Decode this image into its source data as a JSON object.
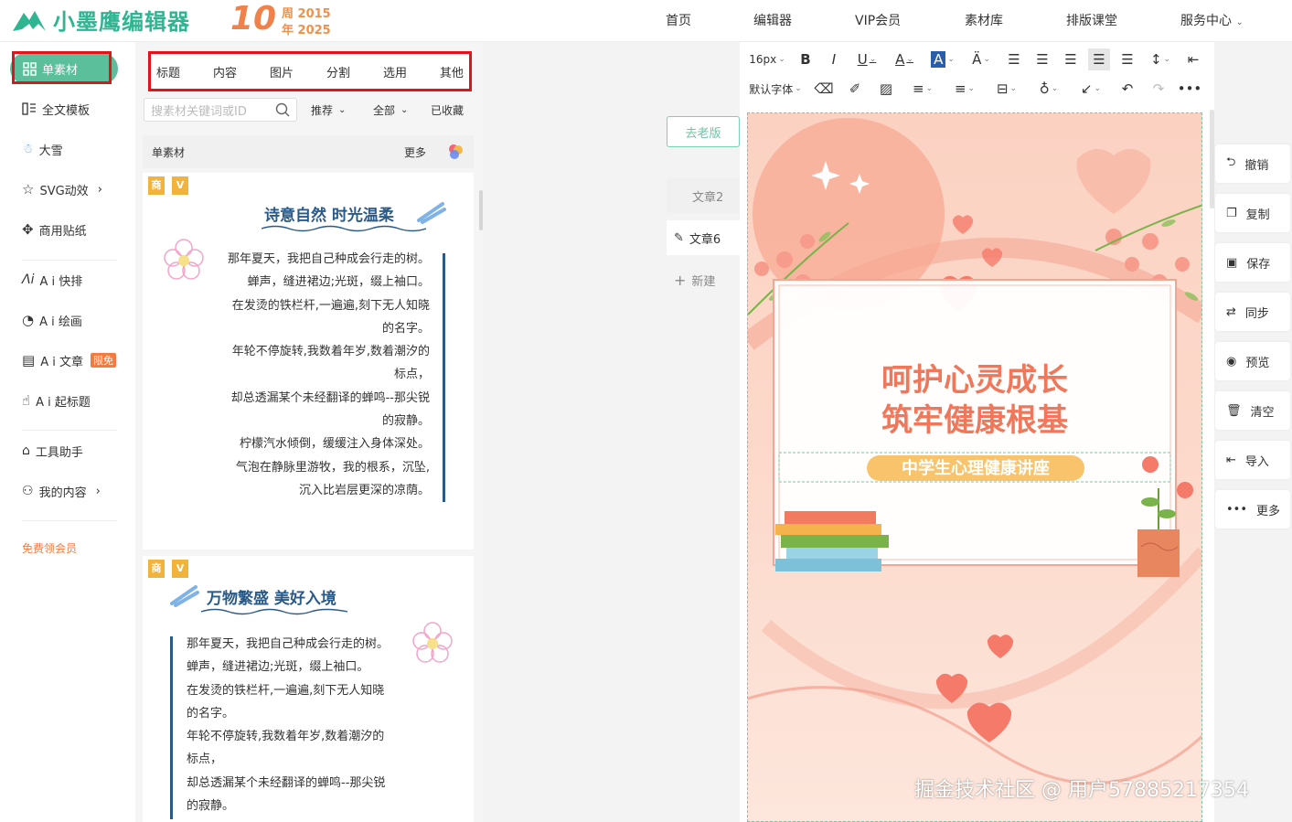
{
  "header": {
    "logo_text": "小墨鹰编辑器",
    "anniv_num": "10",
    "anniv_l1": "周 2015",
    "anniv_l2": "年 2025",
    "nav": [
      "首页",
      "编辑器",
      "VIP会员",
      "素材库",
      "排版课堂",
      "服务中心"
    ]
  },
  "sidebar": {
    "active": "单素材",
    "items": [
      "全文模板",
      "大雪",
      "SVG动效",
      "商用贴纸",
      "A i 快排",
      "A i 绘画",
      "A i 文章",
      "A i 起标题",
      "工具助手",
      "我的内容"
    ],
    "badge": "限免",
    "free_vip": "免费领会员"
  },
  "panel": {
    "tabs": [
      "标题",
      "内容",
      "图片",
      "分割",
      "选用",
      "其他"
    ],
    "search_placeholder": "搜素材关键词或ID",
    "filter1": "推荐",
    "filter2": "全部",
    "favorites": "已收藏",
    "section_title": "单素材",
    "more": "更多",
    "tag_shang": "商",
    "tag_v": "V",
    "card1": {
      "title": "诗意自然 时光温柔",
      "lines": [
        "那年夏天，我把自己种成会行走的树。",
        "蝉声，缝进裙边;光斑，缀上袖口。",
        "在发烫的铁栏杆,一遍遍,刻下无人知晓",
        "的名字。",
        "年轮不停旋转,我数着年岁,数着潮汐的",
        "标点，",
        "却总透漏某个未经翻译的蝉鸣--那尖锐",
        "的寂静。",
        "柠檬汽水倾倒，缓缓注入身体深处。",
        "气泡在静脉里游牧，我的根系，沉坠,",
        "沉入比岩层更深的凉荫。"
      ]
    },
    "card2": {
      "title": "万物繁盛 美好入境",
      "lines": [
        "那年夏天，我把自己种成会行走的树。",
        "蝉声，缝进裙边;光斑，缀上袖口。",
        "在发烫的铁栏杆,一遍遍,刻下无人知晓",
        "的名字。",
        "年轮不停旋转,我数着年岁,数着潮汐的",
        "标点，",
        "却总透漏某个未经翻译的蝉鸣--那尖锐",
        "的寂静。"
      ]
    }
  },
  "docs": {
    "old_version": "去老版",
    "doc1": "文章2",
    "doc2": "文章6",
    "new": "新建"
  },
  "toolbar": {
    "font_size": "16px",
    "font_family": "默认字体"
  },
  "canvas": {
    "title_line1": "呵护心灵成长",
    "title_line2": "筑牢健康根基",
    "subtitle": "中学生心理健康讲座",
    "title_color": "#f0775a",
    "banner_color": "#f8c36a"
  },
  "actions": [
    "撤销",
    "复制",
    "保存",
    "同步",
    "预览",
    "清空",
    "导入",
    "更多"
  ],
  "watermark": "掘金技术社区 @ 用户57885217354",
  "colors": {
    "brand": "#5bbf9c",
    "highlight": "#e0151b"
  }
}
